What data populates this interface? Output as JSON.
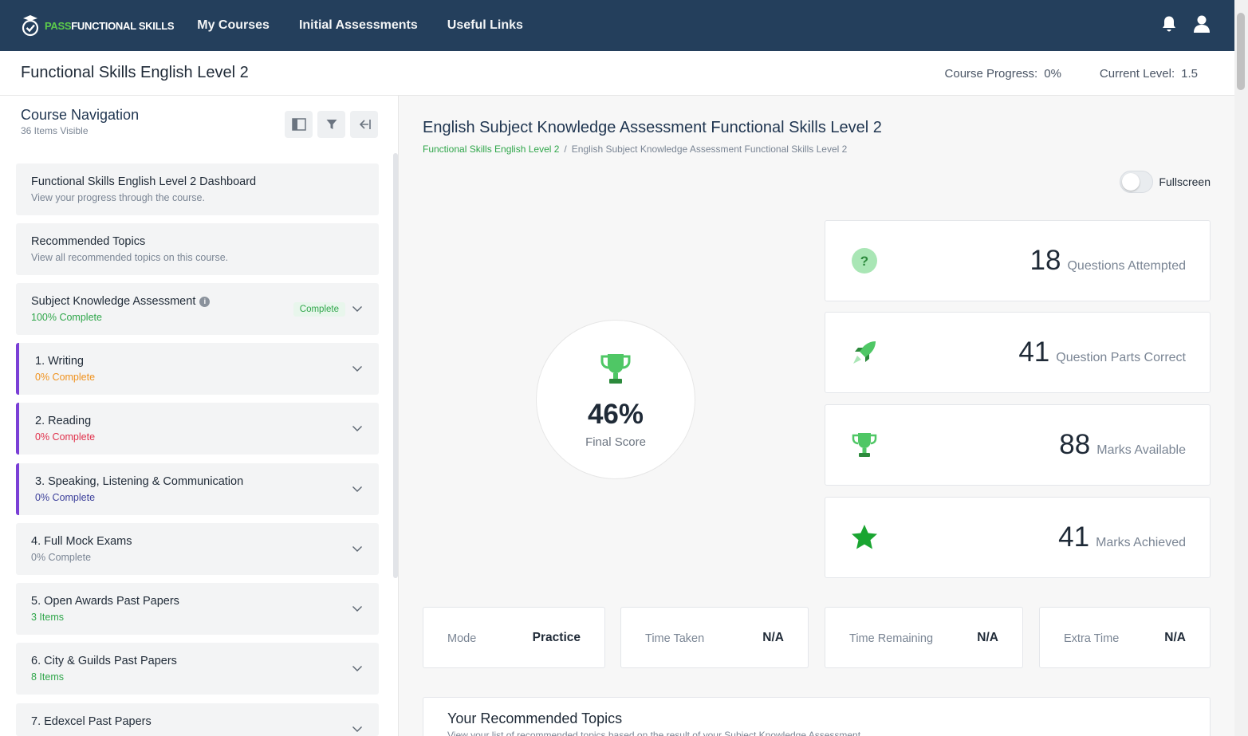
{
  "brand": {
    "pass": "PASS",
    "functional": "FUNCTIONAL SKILLS"
  },
  "nav": {
    "items": [
      "My Courses",
      "Initial Assessments",
      "Useful Links"
    ]
  },
  "course": {
    "title": "Functional Skills English Level 2",
    "progress_label": "Course Progress:",
    "progress_value": "0%",
    "level_label": "Current Level:",
    "level_value": "1.5"
  },
  "sidebar": {
    "title": "Course Navigation",
    "subtitle": "36 Items Visible",
    "items": [
      {
        "title": "Functional Skills English Level 2 Dashboard",
        "subtitle": "View your progress through the course.",
        "subtitle_color": "#7a8594"
      },
      {
        "title": "Recommended Topics",
        "subtitle": "View all recommended topics on this course.",
        "subtitle_color": "#7a8594"
      },
      {
        "title": "Subject Knowledge Assessment",
        "subtitle": "100% Complete",
        "subtitle_color": "#2fa64a",
        "badge": "Complete"
      },
      {
        "title": "1. Writing",
        "subtitle": "0% Complete",
        "subtitle_color": "#f0921e"
      },
      {
        "title": "2. Reading",
        "subtitle": "0% Complete",
        "subtitle_color": "#e0314b"
      },
      {
        "title": "3. Speaking, Listening & Communication",
        "subtitle": "0% Complete",
        "subtitle_color": "#3b3f9a"
      },
      {
        "title": "4. Full Mock Exams",
        "subtitle": "0% Complete",
        "subtitle_color": "#7a8594"
      },
      {
        "title": "5. Open Awards Past Papers",
        "subtitle": "3 Items",
        "subtitle_color": "#2fa64a"
      },
      {
        "title": "6. City & Guilds Past Papers",
        "subtitle": "8 Items",
        "subtitle_color": "#2fa64a"
      },
      {
        "title": "7. Edexcel Past Papers",
        "subtitle": "",
        "subtitle_color": "#2fa64a"
      }
    ]
  },
  "main": {
    "title": "English Subject Knowledge Assessment Functional Skills Level 2",
    "breadcrumb": [
      "Functional Skills English Level 2",
      "English Subject Knowledge Assessment Functional Skills Level 2"
    ],
    "breadcrumb_sep": "/",
    "fullscreen_label": "Fullscreen",
    "score": {
      "value": "46%",
      "label": "Final Score"
    },
    "stats": [
      {
        "icon": "question-icon",
        "value": "18",
        "label": "Questions Attempted"
      },
      {
        "icon": "rocket-icon",
        "value": "41",
        "label": "Question Parts Correct"
      },
      {
        "icon": "trophy-icon",
        "value": "88",
        "label": "Marks Available"
      },
      {
        "icon": "star-icon",
        "value": "41",
        "label": "Marks Achieved"
      }
    ],
    "details": [
      {
        "label": "Mode",
        "value": "Practice"
      },
      {
        "label": "Time Taken",
        "value": "N/A"
      },
      {
        "label": "Time Remaining",
        "value": "N/A"
      },
      {
        "label": "Extra Time",
        "value": "N/A"
      }
    ],
    "recommended": {
      "title": "Your Recommended Topics",
      "subtitle": "View your list of recommended topics based on the result of your Subject Knowledge Assessment."
    }
  },
  "colors": {
    "nav_bg": "#243f5c",
    "accent_green": "#2fa64a",
    "accent_purple": "#7a3fd6"
  }
}
